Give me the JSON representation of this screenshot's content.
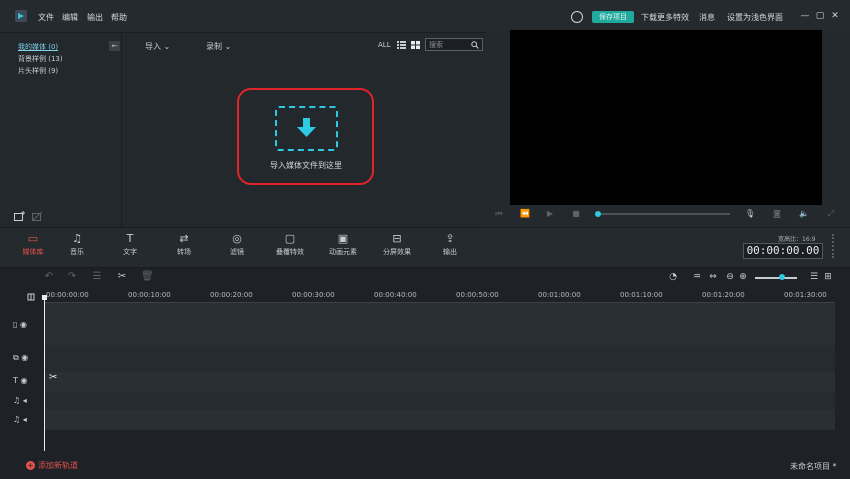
{
  "menu": {
    "file": "文件",
    "edit": "编辑",
    "export": "输出",
    "help": "帮助"
  },
  "titlebar": {
    "save_project": "保存项目",
    "download_effects": "下载更多特效",
    "messages": "消息",
    "light_theme": "设置为浅色界面"
  },
  "media_tree": {
    "items": [
      {
        "label": "我的媒体 (0)"
      },
      {
        "label": "背景样例 (13)"
      },
      {
        "label": "片头样例 (9)"
      }
    ],
    "collapse_icon": "arrow-left-icon"
  },
  "media_toolbar": {
    "import_label": "导入",
    "record_label": "录制",
    "all_label": "ALL",
    "search_placeholder": "搜索"
  },
  "dropzone": {
    "hint": "导入媒体文件到这里",
    "icon": "download-arrow-icon",
    "accent": "#2ec9e2",
    "highlight": "#e0242b"
  },
  "tools": [
    {
      "label": "媒体库",
      "glyph": "▭",
      "icon": "folder-icon",
      "active": true
    },
    {
      "label": "音乐",
      "glyph": "♫",
      "icon": "music-icon",
      "active": false
    },
    {
      "label": "文字",
      "glyph": "T",
      "icon": "text-icon",
      "active": false
    },
    {
      "label": "转场",
      "glyph": "⇄",
      "icon": "transition-icon",
      "active": false
    },
    {
      "label": "滤镜",
      "glyph": "◎",
      "icon": "filter-icon",
      "active": false
    },
    {
      "label": "叠覆特效",
      "glyph": "▢",
      "icon": "overlay-icon",
      "active": false
    },
    {
      "label": "动画元素",
      "glyph": "▣",
      "icon": "animation-icon",
      "active": false
    },
    {
      "label": "分屏效果",
      "glyph": "⊟",
      "icon": "split-screen-icon",
      "active": false
    },
    {
      "label": "输出",
      "glyph": "⇪",
      "icon": "export-icon",
      "active": false
    }
  ],
  "preview": {
    "ratio": "宽高比：16:9",
    "timecode": "00:00:00.00"
  },
  "ruler": {
    "ticks": [
      "00:00:00:00",
      "00:00:10:00",
      "00:00:20:00",
      "00:00:30:00",
      "00:00:40:00",
      "00:00:50:00",
      "00:01:00:00",
      "00:01:10:00",
      "00:01:20:00",
      "00:01:30:00"
    ]
  },
  "footer": {
    "add_track": "添加新轨道",
    "project_name": "未命名项目 *"
  }
}
